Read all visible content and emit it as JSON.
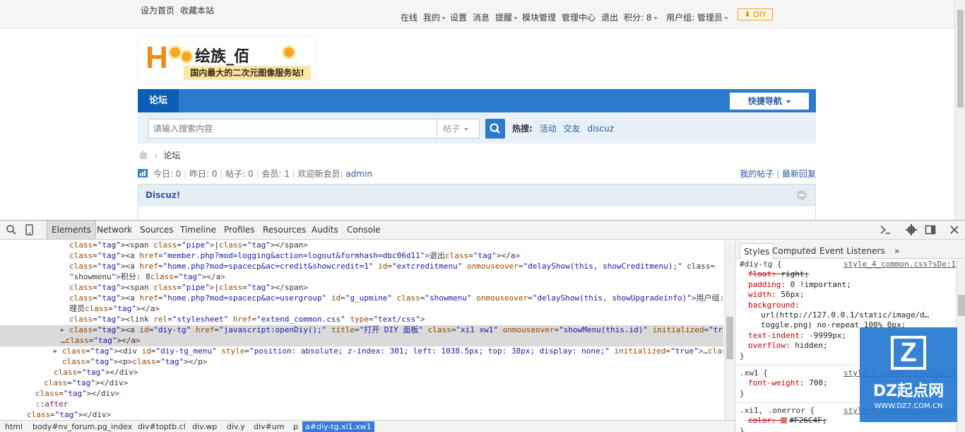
{
  "topbar": {
    "set_home": "设为首页",
    "bookmark": "收藏本站",
    "online": "在线",
    "my": "我的",
    "settings": "设置",
    "messages": "消息",
    "reminders": "提醒",
    "module_manage": "模块管理",
    "admin_center": "管理中心",
    "logout": "退出",
    "credits": "积分: 8",
    "usergroup": "用户组: 管理员",
    "diy": "DIY"
  },
  "logo": {
    "letter": "H",
    "brand": "绘族_佰",
    "tagline": "国内最大的二次元图像服务站!"
  },
  "nav": {
    "forum": "论坛",
    "quick_nav": "快捷导航"
  },
  "search": {
    "placeholder": "请输入搜索内容",
    "type": "帖子",
    "hot_label": "热搜:",
    "hot_items": [
      "活动",
      "交友",
      "discuz"
    ]
  },
  "breadcrumb": {
    "current": "论坛"
  },
  "stats": {
    "today": "今日: 0",
    "yesterday": "昨日: 0",
    "posts": "帖子: 0",
    "members": "会员: 1",
    "welcome": "欢迎新会员:",
    "new_member": "admin",
    "my_posts": "我的帖子",
    "latest_replies": "最新回复"
  },
  "forum_group": {
    "title": "Discuz!"
  },
  "devtools": {
    "tabs": [
      "Elements",
      "Network",
      "Sources",
      "Timeline",
      "Profiles",
      "Resources",
      "Audits",
      "Console"
    ],
    "active_tab": "Elements",
    "dom_lines": [
      "<span class=\"pipe\">|</span>",
      "<a href=\"member.php?mod=logging&action=logout&formhash=dbc06d11\">退出</a>",
      "<a href=\"home.php?mod=spacecp&ac=credit&showcredit=1\" id=\"extcreditmenu\" onmouseover=\"delayShow(this, showCreditmenu);\" class=",
      "\"showmenu\">积分: 8</a>",
      "<span class=\"pipe\">|</span>",
      "<a href=\"home.php?mod=spacecp&ac=usergroup\" id=\"g_upmine\" class=\"showmenu\" onmouseover=\"delayShow(this, showUpgradeinfo)\">用户组: 管",
      "理员</a>",
      "<link rel=\"stylesheet\" href=\"extend_common.css\" type=\"text/css\">",
      "<a id=\"diy-tg\" href=\"javascript:openDiy();\" title=\"打开 DIY 面板\" class=\"xi1 xw1\" onmouseover=\"showMenu(this.id)\" initialized=\"true\">",
      "…</a>",
      "<div id=\"diy-tg_menu\" style=\"position: absolute; z-index: 301; left: 1038.5px; top: 38px; display: none;\" initialized=\"true\">…</div>",
      "<p></p>",
      "</div>",
      "</div>",
      "</div>",
      "::after",
      "</div>"
    ],
    "breadcrumbs": [
      "html",
      "body#nv_forum.pg_index",
      "div#toptb.cl",
      "div.wp",
      "div.y",
      "div#um",
      "p",
      "a#diy-tg.xi1.xw1"
    ],
    "selected_crumb": "a#diy-tg.xi1.xw1",
    "styles_tabs": [
      "Styles",
      "Computed",
      "Event Listeners"
    ],
    "styles_more": "»",
    "rules": [
      {
        "selector": "#diy-tg {",
        "source": "style_4_common.css?sDe:1"
      },
      {
        "prop": "float",
        "value": "right;",
        "struck": true
      },
      {
        "prop": "padding",
        "value": "0 !important;"
      },
      {
        "prop": "width",
        "value": "56px;"
      },
      {
        "prop": "background",
        "value": ""
      },
      {
        "prop": "",
        "value": "url(http://127.0.0.1/static/image/d…"
      },
      {
        "prop": "",
        "value": "toggle.png) no-repeat 100% 0px;"
      },
      {
        "prop": "text-indent",
        "value": "-9999px;"
      },
      {
        "prop": "overflow",
        "value": "hidden;"
      },
      {
        "selector": "}",
        "source": ""
      },
      {
        "selector": ".xw1 {",
        "source": "style_4_common.css?sDe:1"
      },
      {
        "prop": "font-weight",
        "value": "700;"
      },
      {
        "selector": "}",
        "source": ""
      },
      {
        "selector": ".xi1, .onerror {",
        "source": "style_4_common.css?sDe:1"
      },
      {
        "prop": "color",
        "value": "#F26C4F;",
        "struck": true,
        "swatch": "#F26C4F"
      },
      {
        "selector": "}",
        "source": ""
      }
    ]
  },
  "watermark": {
    "logo": "Z",
    "name": "DZ起点网",
    "url": "WWW.DZ7.COM.CN"
  },
  "colors": {
    "nav_blue": "#2b7acd",
    "nav_active": "#0b5eb5",
    "link_blue": "#2b5aa0",
    "selection": "#3879d9"
  }
}
